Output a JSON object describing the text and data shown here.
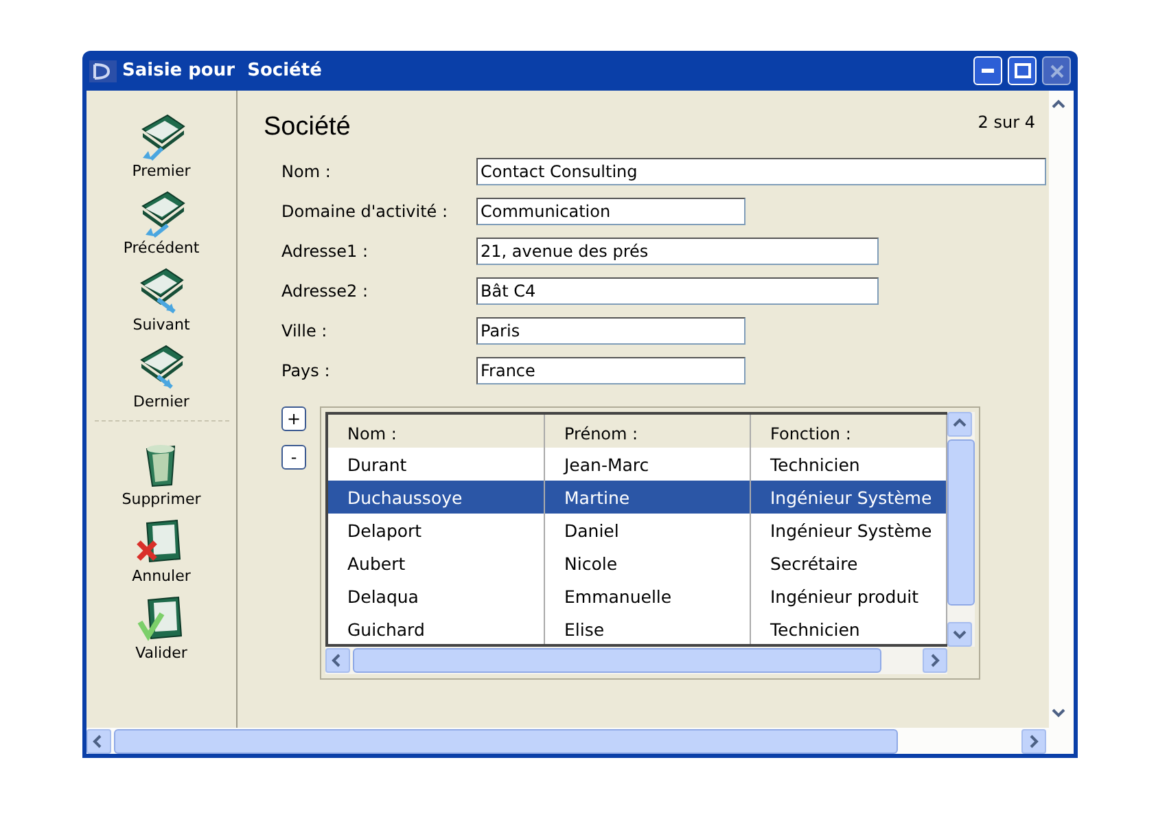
{
  "window": {
    "title": "Saisie pour  Société",
    "close_disabled": true
  },
  "toolbar": {
    "groups": [
      [
        {
          "kind": "first",
          "label": "Premier"
        },
        {
          "kind": "previous",
          "label": "Précédent"
        },
        {
          "kind": "next",
          "label": "Suivant"
        },
        {
          "kind": "last",
          "label": "Dernier"
        }
      ],
      [
        {
          "kind": "delete",
          "label": "Supprimer"
        },
        {
          "kind": "cancel",
          "label": "Annuler"
        },
        {
          "kind": "validate",
          "label": "Valider"
        }
      ]
    ]
  },
  "form": {
    "heading": "Société",
    "record_counter": "2 sur 4",
    "fields": [
      {
        "label": "Nom :",
        "value": "Contact Consulting"
      },
      {
        "label": "Domaine d'activité :",
        "value": "Communication"
      },
      {
        "label": "Adresse1 :",
        "value": "21, avenue des prés"
      },
      {
        "label": "Adresse2 :",
        "value": "Bât C4"
      },
      {
        "label": "Ville :",
        "value": "Paris"
      },
      {
        "label": "Pays :",
        "value": "France"
      }
    ]
  },
  "table": {
    "add_button": "+",
    "remove_button": "-",
    "columns": [
      "Nom :",
      "Prénom :",
      "Fonction :"
    ],
    "rows": [
      {
        "cells": [
          "Durant",
          "Jean-Marc",
          "Technicien"
        ],
        "selected": false
      },
      {
        "cells": [
          "Duchaussoye",
          "Martine",
          "Ingénieur Système"
        ],
        "selected": true
      },
      {
        "cells": [
          "Delaport",
          "Daniel",
          "Ingénieur Système"
        ],
        "selected": false
      },
      {
        "cells": [
          "Aubert",
          "Nicole",
          "Secrétaire"
        ],
        "selected": false
      },
      {
        "cells": [
          "Delaqua",
          "Emmanuelle",
          "Ingénieur produit"
        ],
        "selected": false
      },
      {
        "cells": [
          "Guichard",
          "Elise",
          "Technicien"
        ],
        "selected": false
      }
    ]
  }
}
